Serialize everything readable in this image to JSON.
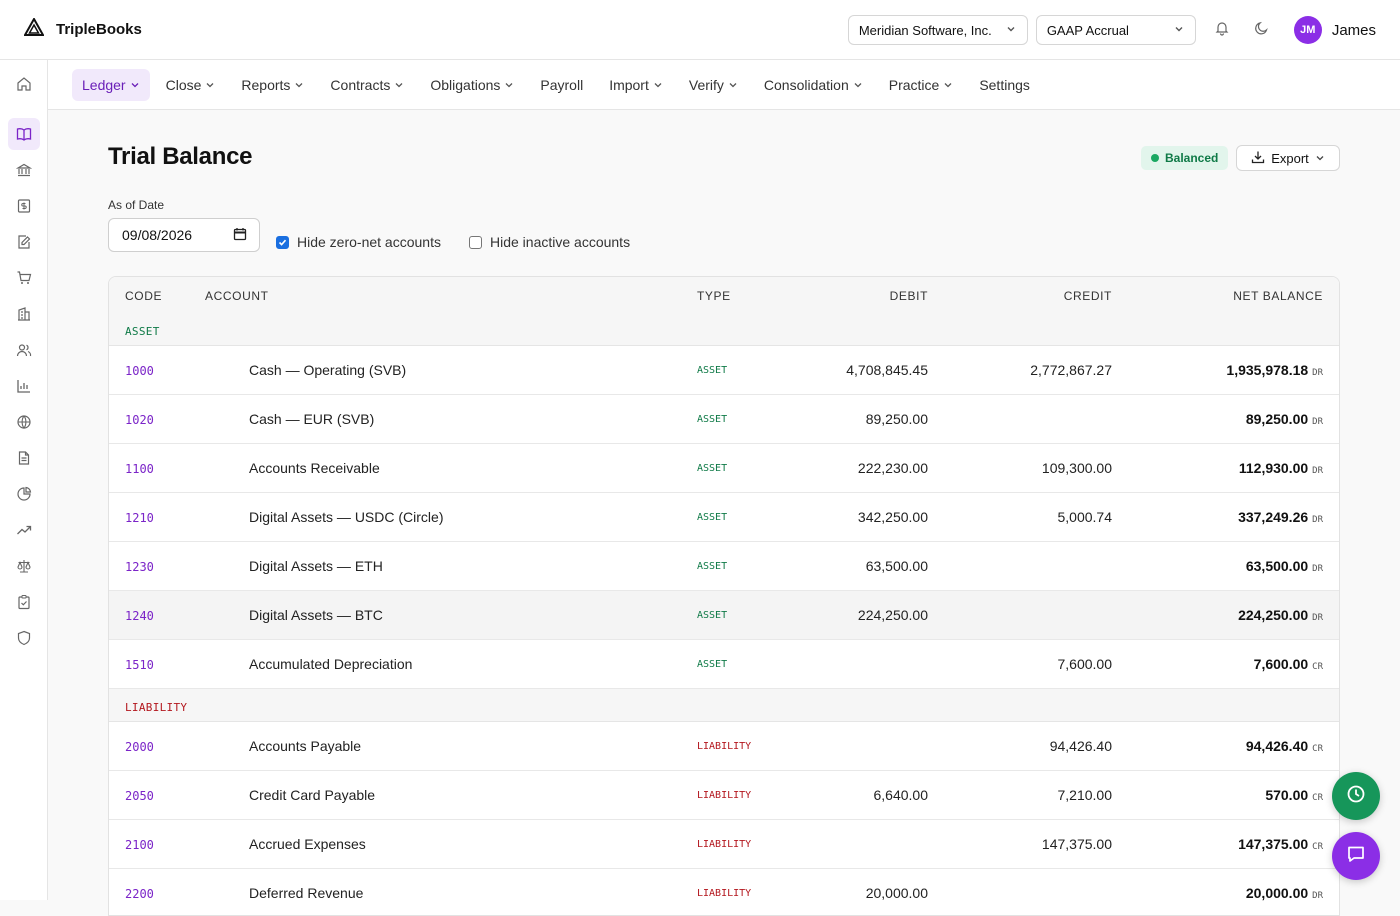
{
  "brand": {
    "name": "TripleBooks"
  },
  "header": {
    "company": "Meridian Software, Inc.",
    "basis": "GAAP Accrual",
    "user_initials": "JM",
    "user_name": "James"
  },
  "sidebar": {
    "items": [
      "home-icon",
      "book-icon",
      "bank-icon",
      "dollar-doc-icon",
      "edit-doc-icon",
      "cart-icon",
      "building-icon",
      "users-icon",
      "bar-chart-icon",
      "globe-icon",
      "file-text-icon",
      "pie-chart-icon",
      "trend-icon",
      "scale-icon",
      "clipboard-check-icon",
      "shield-icon"
    ],
    "active": "book-icon"
  },
  "nav": {
    "items": [
      {
        "label": "Ledger",
        "dropdown": true,
        "active": true
      },
      {
        "label": "Close",
        "dropdown": true
      },
      {
        "label": "Reports",
        "dropdown": true
      },
      {
        "label": "Contracts",
        "dropdown": true
      },
      {
        "label": "Obligations",
        "dropdown": true
      },
      {
        "label": "Payroll",
        "dropdown": false
      },
      {
        "label": "Import",
        "dropdown": true
      },
      {
        "label": "Verify",
        "dropdown": true
      },
      {
        "label": "Consolidation",
        "dropdown": true
      },
      {
        "label": "Practice",
        "dropdown": true
      },
      {
        "label": "Settings",
        "dropdown": false
      }
    ]
  },
  "page": {
    "title": "Trial Balance",
    "status": "Balanced",
    "export_label": "Export",
    "date_label": "As of Date",
    "date_value": "09/08/2026",
    "hide_zero_label": "Hide zero-net accounts",
    "hide_zero_checked": true,
    "hide_inactive_label": "Hide inactive accounts",
    "hide_inactive_checked": false
  },
  "table": {
    "columns": [
      "CODE",
      "ACCOUNT",
      "TYPE",
      "DEBIT",
      "CREDIT",
      "NET BALANCE"
    ],
    "groups": [
      {
        "label": "ASSET",
        "color": "#0f7a47",
        "rows": [
          {
            "code": "1000",
            "account": "Cash — Operating (SVB)",
            "type": "ASSET",
            "debit": "4,708,845.45",
            "credit": "2,772,867.27",
            "net": "1,935,978.18",
            "side": "DR"
          },
          {
            "code": "1020",
            "account": "Cash — EUR (SVB)",
            "type": "ASSET",
            "debit": "89,250.00",
            "credit": "",
            "net": "89,250.00",
            "side": "DR"
          },
          {
            "code": "1100",
            "account": "Accounts Receivable",
            "type": "ASSET",
            "debit": "222,230.00",
            "credit": "109,300.00",
            "net": "112,930.00",
            "side": "DR"
          },
          {
            "code": "1210",
            "account": "Digital Assets — USDC (Circle)",
            "type": "ASSET",
            "debit": "342,250.00",
            "credit": "5,000.74",
            "net": "337,249.26",
            "side": "DR"
          },
          {
            "code": "1230",
            "account": "Digital Assets — ETH",
            "type": "ASSET",
            "debit": "63,500.00",
            "credit": "",
            "net": "63,500.00",
            "side": "DR"
          },
          {
            "code": "1240",
            "account": "Digital Assets — BTC",
            "type": "ASSET",
            "debit": "224,250.00",
            "credit": "",
            "net": "224,250.00",
            "side": "DR",
            "highlight": true
          },
          {
            "code": "1510",
            "account": "Accumulated Depreciation",
            "type": "ASSET",
            "debit": "",
            "credit": "7,600.00",
            "net": "7,600.00",
            "side": "CR"
          }
        ]
      },
      {
        "label": "LIABILITY",
        "color": "#b3161d",
        "rows": [
          {
            "code": "2000",
            "account": "Accounts Payable",
            "type": "LIABILITY",
            "debit": "",
            "credit": "94,426.40",
            "net": "94,426.40",
            "side": "CR"
          },
          {
            "code": "2050",
            "account": "Credit Card Payable",
            "type": "LIABILITY",
            "debit": "6,640.00",
            "credit": "7,210.00",
            "net": "570.00",
            "side": "CR"
          },
          {
            "code": "2100",
            "account": "Accrued Expenses",
            "type": "LIABILITY",
            "debit": "",
            "credit": "147,375.00",
            "net": "147,375.00",
            "side": "CR"
          },
          {
            "code": "2200",
            "account": "Deferred Revenue",
            "type": "LIABILITY",
            "debit": "20,000.00",
            "credit": "",
            "net": "20,000.00",
            "side": "DR"
          }
        ]
      }
    ]
  },
  "fabs": [
    "clock-icon",
    "chat-icon"
  ]
}
